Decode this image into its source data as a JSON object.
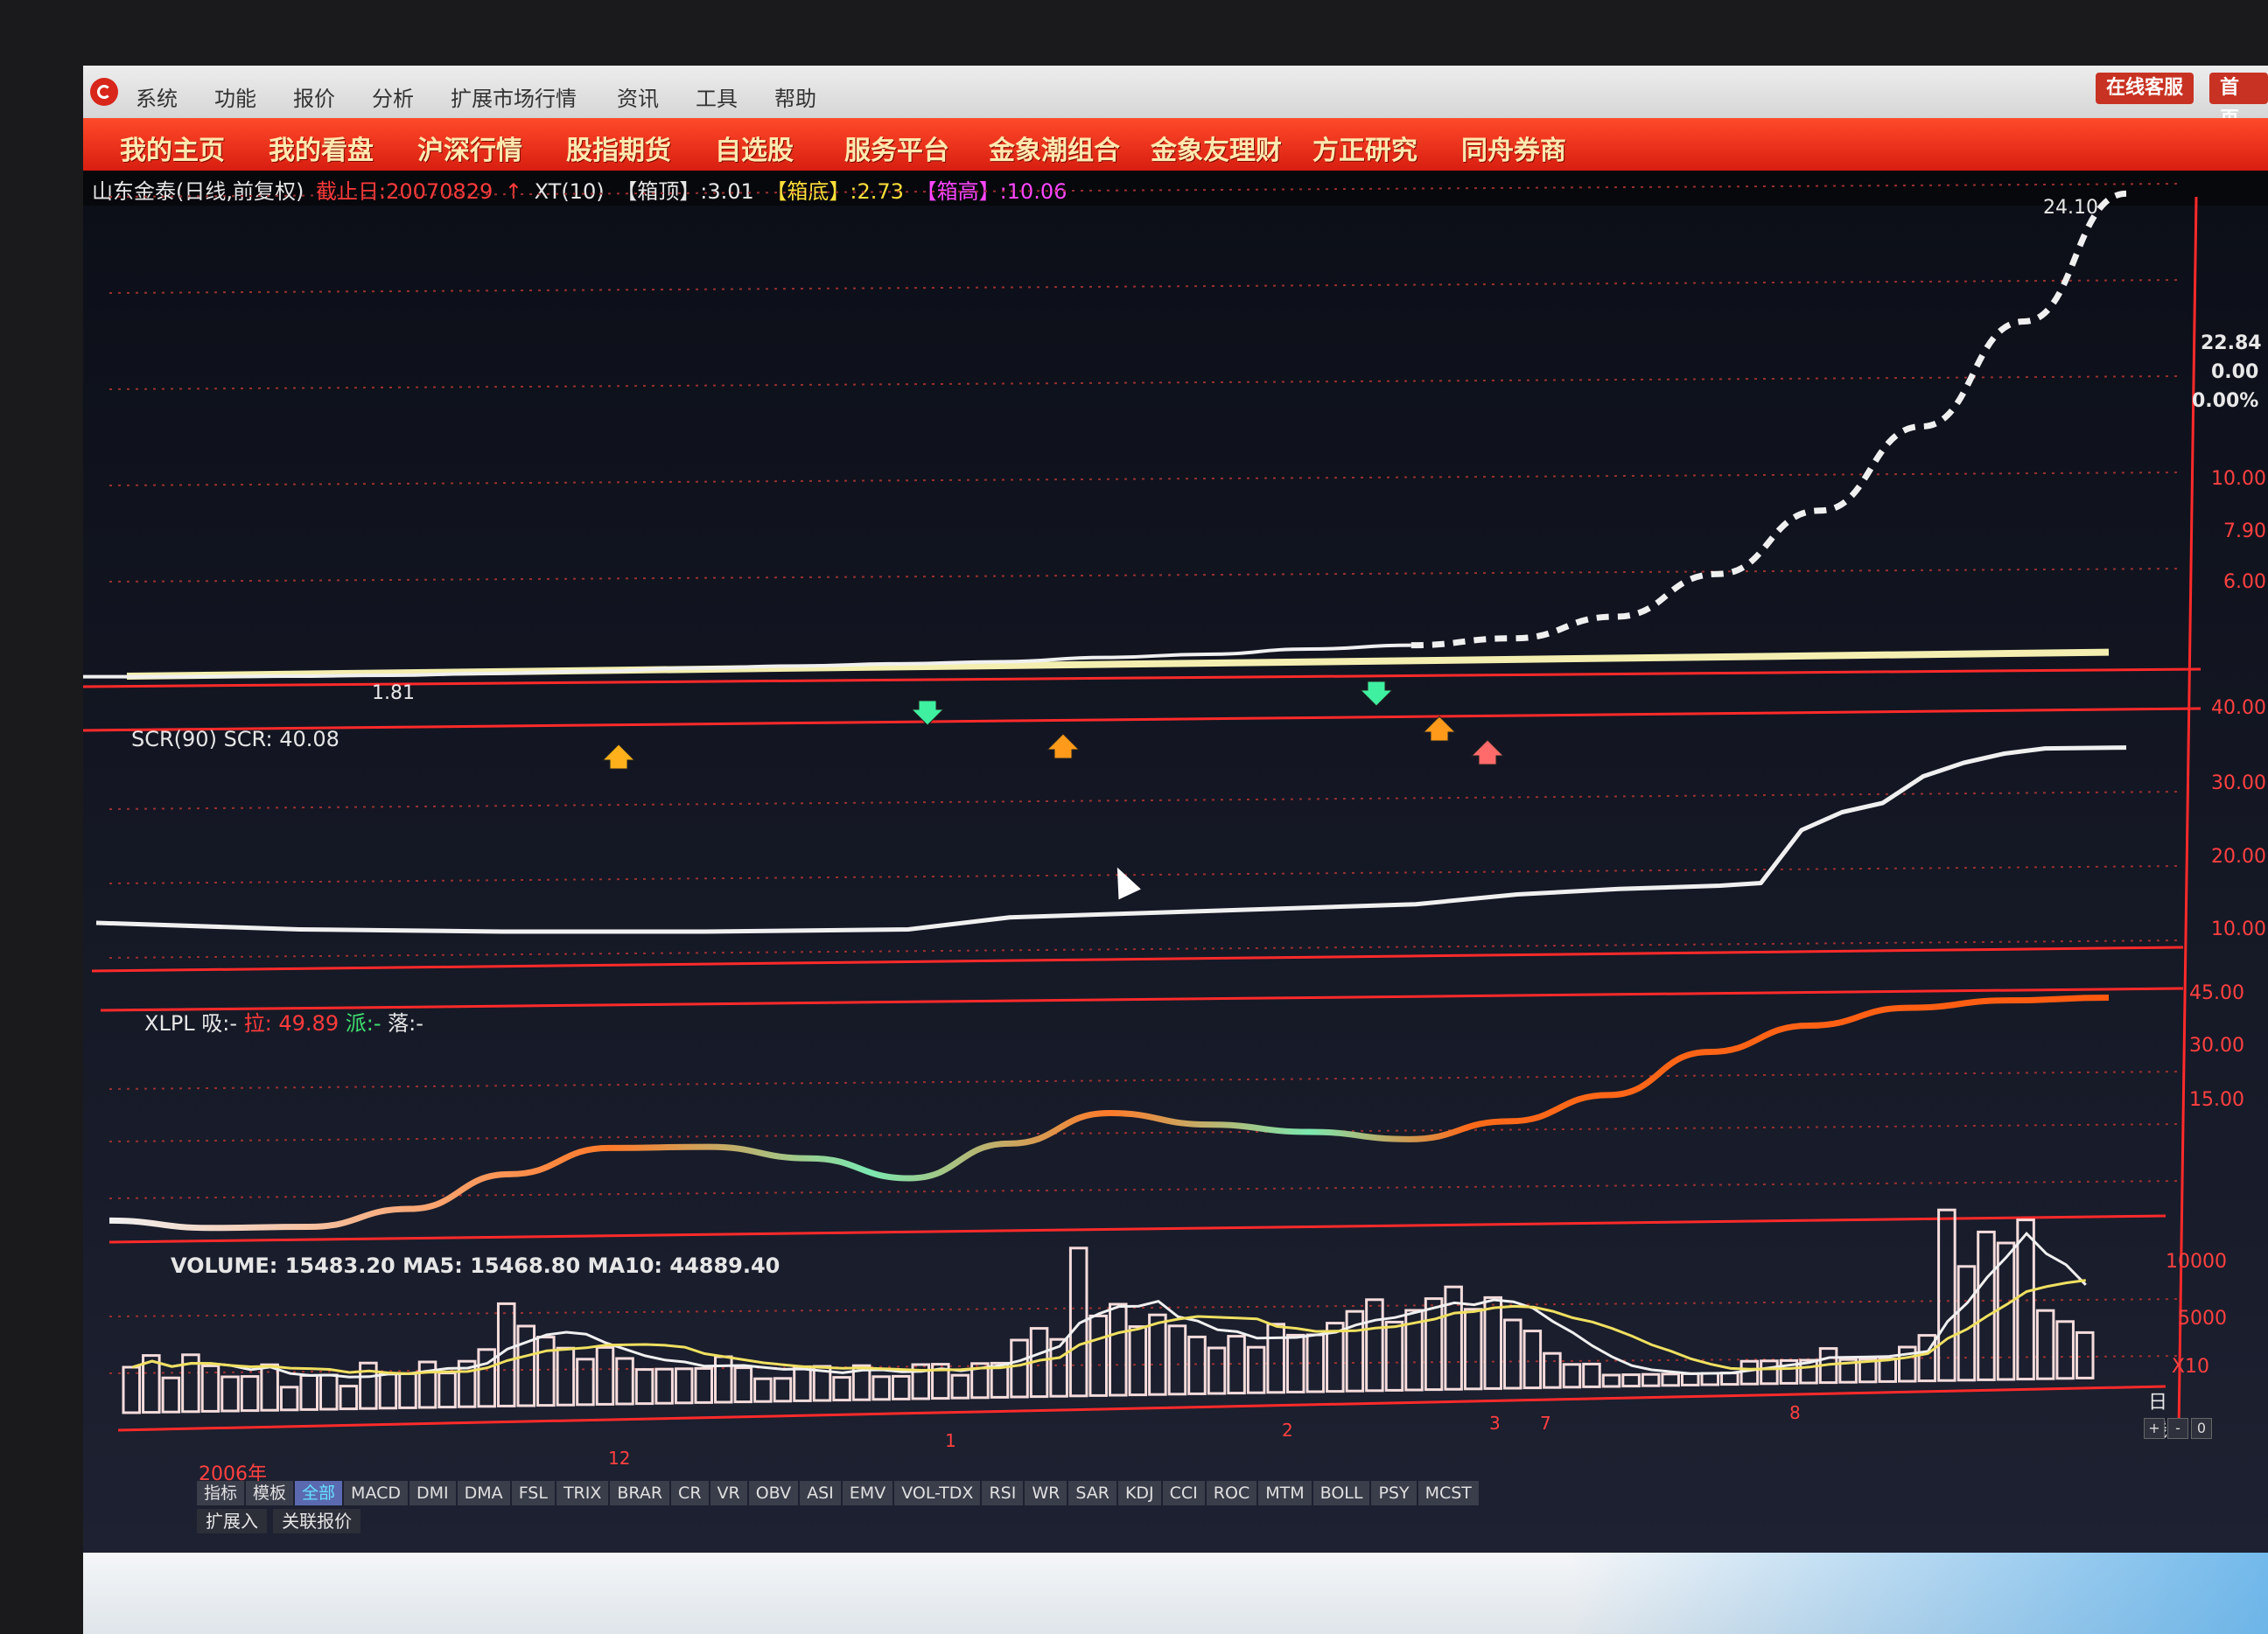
{
  "menubar": {
    "items": [
      "系统",
      "功能",
      "报价",
      "分析",
      "扩展市场行情",
      "资讯",
      "工具",
      "帮助"
    ],
    "right_buttons": [
      "在线客服",
      "首页"
    ]
  },
  "navbar": {
    "items": [
      "我的主页",
      "我的看盘",
      "沪深行情",
      "股指期货",
      "自选股",
      "服务平台",
      "金象潮组合",
      "金象友理财",
      "方正研究",
      "同舟券商"
    ]
  },
  "chart_header": {
    "stock_name": "山东金泰(日线,前复权)",
    "cutoff_date": "截止日:20070829",
    "indicator": "XT(10)",
    "top_label": "【箱顶】:3.01",
    "bottom_label": "【箱底】:2.73",
    "high_label": "【箱高】:10.06"
  },
  "price_panel": {
    "high_tag": "24.10",
    "low_tag": "1.81",
    "side_values": [
      "22.84",
      "0.00",
      "0.00%"
    ],
    "axis": [
      "10.00",
      "7.90",
      "6.00"
    ]
  },
  "scr_panel": {
    "label": "SCR(90)  SCR: 40.08",
    "axis": [
      "40.00",
      "30.00",
      "20.00",
      "10.00"
    ]
  },
  "xlpl_panel": {
    "label_prefix": "XLPL  吸:-",
    "la": "拉: 49.89",
    "pai": "派:-",
    "luo": "落:-",
    "axis": [
      "45.00",
      "30.00",
      "15.00"
    ]
  },
  "volume_panel": {
    "label": "VOLUME: 15483.20  MA5: 15468.80  MA10: 44889.40",
    "axis": [
      "10000",
      "5000"
    ],
    "unit": "X10"
  },
  "time_axis": {
    "year": "2006年",
    "months": [
      "12",
      "1",
      "2",
      "3",
      "7",
      "8"
    ]
  },
  "controls": {
    "period": "日线",
    "buttons": [
      "+",
      "-",
      "0"
    ]
  },
  "indicator_tabs": [
    "指标",
    "模板",
    "全部",
    "MACD",
    "DMI",
    "DMA",
    "FSL",
    "TRIX",
    "BRAR",
    "CR",
    "VR",
    "OBV",
    "ASI",
    "EMV",
    "VOL-TDX",
    "RSI",
    "WR",
    "SAR",
    "KDJ",
    "CCI",
    "ROC",
    "MTM",
    "BOLL",
    "PSY",
    "MCST"
  ],
  "active_tab": "全部",
  "bottom_buttons": [
    "扩展入",
    "关联报价"
  ],
  "colors": {
    "grid_red": "#ff2a2a",
    "line_white": "#f0f0f0",
    "line_orange": "#ff6a1a",
    "line_yellow": "#f0e060",
    "line_green": "#7be8b0"
  },
  "chart_data": [
    {
      "type": "line",
      "name": "price",
      "x": [
        0,
        5,
        10,
        15,
        20,
        25,
        30,
        35,
        40,
        45,
        50,
        55,
        60,
        65,
        70,
        75,
        80,
        85,
        90,
        95,
        100
      ],
      "values": [
        1.9,
        1.85,
        1.82,
        1.81,
        1.85,
        1.9,
        2.0,
        2.05,
        2.1,
        2.15,
        2.3,
        2.4,
        2.6,
        2.73,
        3.01,
        4.0,
        6.0,
        9.0,
        13.0,
        18.0,
        24.1
      ],
      "ylim": [
        1.0,
        25.0
      ]
    },
    {
      "type": "line",
      "name": "SCR",
      "x": [
        0,
        10,
        20,
        30,
        40,
        45,
        50,
        55,
        60,
        65,
        70,
        75,
        80,
        82,
        84,
        86,
        88,
        90,
        92,
        94,
        96,
        100
      ],
      "values": [
        5,
        3,
        2,
        1.5,
        1.5,
        4,
        4.5,
        5,
        5.5,
        6,
        8,
        9,
        9.5,
        10,
        22,
        26,
        28,
        34,
        37,
        39,
        40.08,
        40.08
      ],
      "ylim": [
        0,
        45
      ]
    },
    {
      "type": "line",
      "name": "XLPL",
      "x": [
        0,
        5,
        10,
        15,
        20,
        25,
        30,
        35,
        40,
        45,
        50,
        55,
        60,
        65,
        70,
        75,
        80,
        85,
        90,
        95,
        100
      ],
      "values": [
        2,
        0,
        0,
        4,
        12,
        18,
        18,
        15,
        10,
        18,
        25,
        22,
        20,
        18,
        22,
        28,
        38,
        44,
        48,
        49.5,
        49.89
      ],
      "ylim": [
        0,
        50
      ]
    },
    {
      "type": "bar",
      "name": "VOLUME",
      "values": [
        4,
        5,
        3,
        5,
        4,
        3,
        3,
        4,
        2,
        3,
        3,
        2,
        4,
        3,
        3,
        4,
        3,
        4,
        5,
        9,
        7,
        6,
        5,
        4,
        5,
        4,
        3,
        3,
        3,
        3,
        4,
        3,
        2,
        2,
        3,
        3,
        2,
        3,
        2,
        2,
        3,
        3,
        2,
        3,
        3,
        5,
        6,
        5,
        13,
        7,
        8,
        6,
        7,
        6,
        5,
        4,
        5,
        4,
        6,
        5,
        5,
        6,
        7,
        8,
        6,
        7,
        8,
        9,
        7,
        8,
        6,
        5,
        3,
        2,
        2,
        1,
        1,
        1,
        1,
        1,
        1,
        1,
        2,
        2,
        2,
        2,
        3,
        2,
        2,
        2,
        3,
        4,
        15,
        10,
        13,
        12,
        14,
        6,
        5,
        4
      ],
      "ylim": [
        0,
        16
      ]
    }
  ]
}
